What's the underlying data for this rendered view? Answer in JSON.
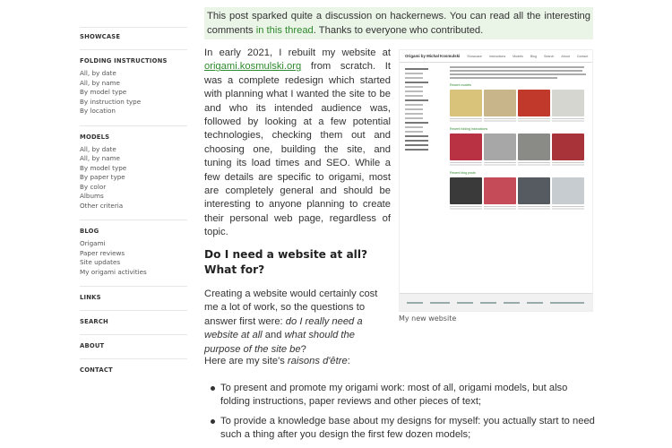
{
  "notice": {
    "text_before": "This post sparked quite a discussion on hackernews. You can read all the interesting comments ",
    "link": "in this thread",
    "text_after": ". Thanks to everyone who contributed."
  },
  "sidebar": {
    "showcase": "SHOWCASE",
    "folding": {
      "title": "FOLDING INSTRUCTIONS",
      "items": [
        "All, by date",
        "All, by name",
        "By model type",
        "By instruction type",
        "By location"
      ]
    },
    "models": {
      "title": "MODELS",
      "items": [
        "All, by date",
        "All, by name",
        "By model type",
        "By paper type",
        "By color",
        "Albums",
        "Other criteria"
      ]
    },
    "blog": {
      "title": "BLOG",
      "items": [
        "Origami",
        "Paper reviews",
        "Site updates",
        "My origami activities"
      ]
    },
    "links": "LINKS",
    "search": "SEARCH",
    "about": "ABOUT",
    "contact": "CONTACT"
  },
  "intro": {
    "text_before": "In early 2021, I rebuilt my website at ",
    "link": "origami.kosmulski.org",
    "text_after": " from scratch. It was a complete redesign which started with planning what I wanted the site to be and who its intended audience was, followed by looking at a few potential technologies, checking them out and choosing one, building the site, and tuning its load times and SEO. While a few details are specific to origami, most are completely general and should be interesting to anyone planning to create their personal web page, regardless of topic."
  },
  "figure": {
    "mini_logo": "Origami by Michał Kosmulski",
    "mini_nav": [
      "Showcase",
      "Instructions",
      "Models",
      "Blog",
      "Search",
      "About",
      "Contact"
    ],
    "sections": [
      "Recent models",
      "Recent folding instructions",
      "Recent blog posts"
    ],
    "caption": "My new website"
  },
  "heading": "Do I need a website at all? What for?",
  "para2": {
    "text": "Creating a website would certainly cost me a lot of work, so the questions to answer first were: ",
    "em1": "do I really need a website at all",
    "and": " and ",
    "em2": "what should the purpose of the site be",
    "end": "?"
  },
  "para3": {
    "text": "Here are my site's ",
    "em": "raisons d'être",
    "end": ":"
  },
  "bullets": [
    "To present and promote my origami work: most of all, origami models, but also folding instructions, paper reviews and other pieces of text;",
    "To provide a knowledge base about my designs for myself: you actually start to need such a thing after you design the first few dozen models;"
  ],
  "colors": {
    "link_green": "#2e8a2e",
    "notice_bg": "#eaf4e7"
  }
}
